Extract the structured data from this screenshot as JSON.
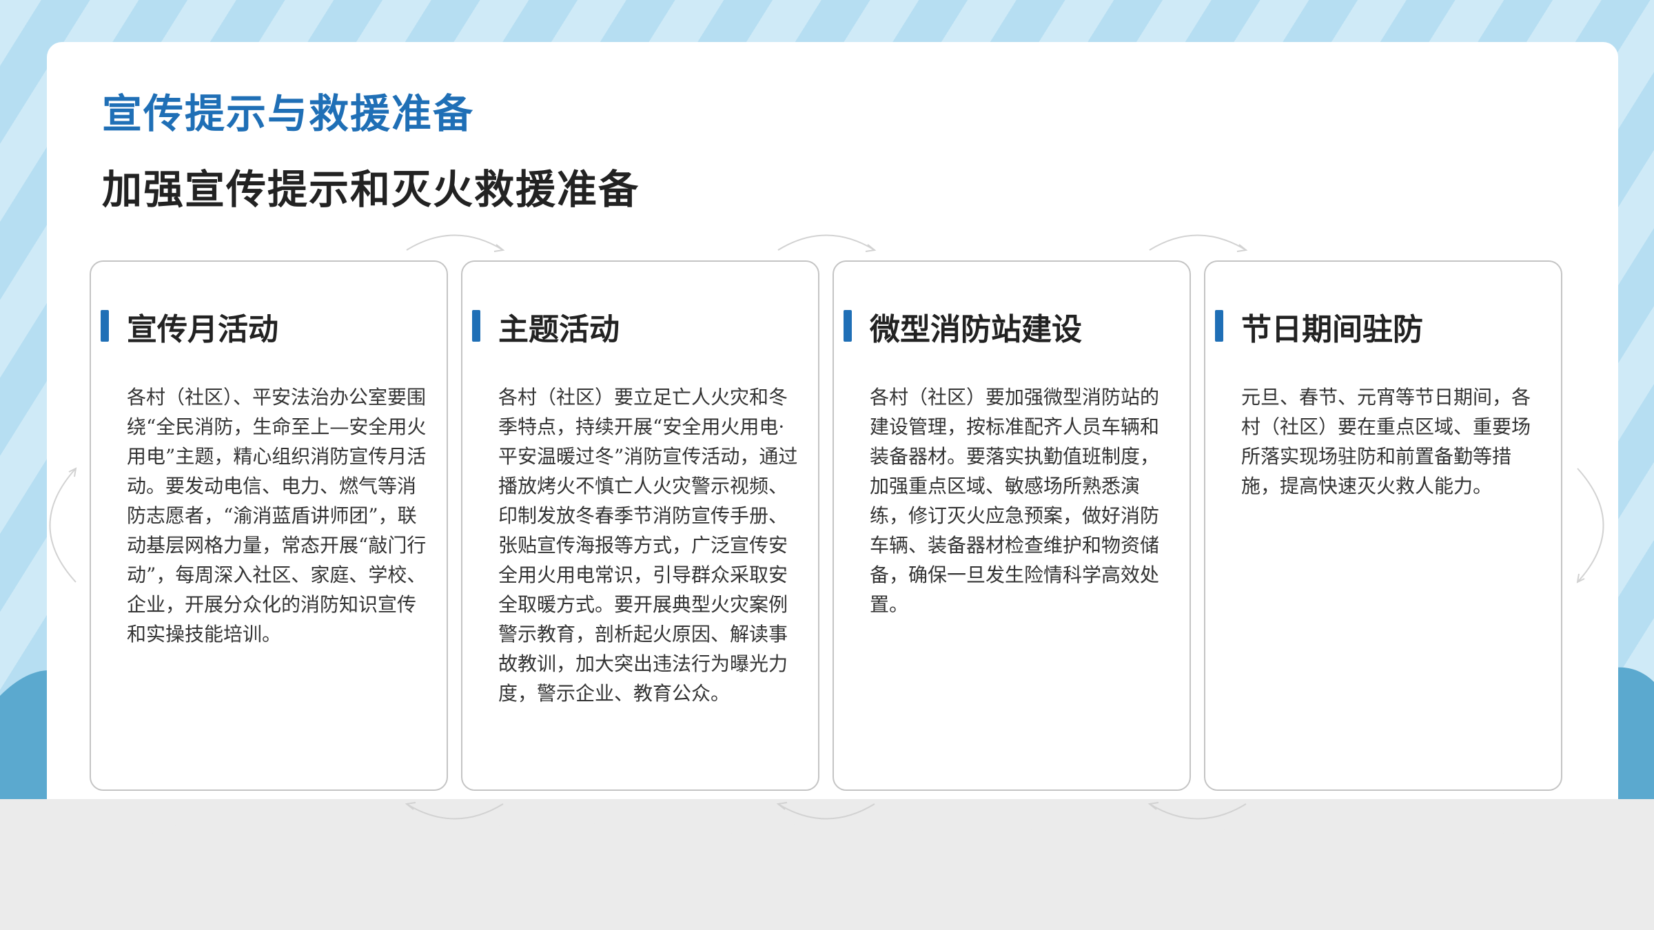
{
  "title": "宣传提示与救援准备",
  "subtitle": "加强宣传提示和灭火救援准备",
  "cards": [
    {
      "heading": "宣传月活动",
      "body": "各村（社区）、平安法治办公室要围绕“全民消防，生命至上—安全用火用电”主题，精心组织消防宣传月活动。要发动电信、电力、燃气等消防志愿者，“渝消蓝盾讲师团”，联动基层网格力量，常态开展“敲门行动”，每周深入社区、家庭、学校、企业，开展分众化的消防知识宣传和实操技能培训。"
    },
    {
      "heading": "主题活动",
      "body": "各村（社区）要立足亡人火灾和冬季特点，持续开展“安全用火用电·平安温暖过冬”消防宣传活动，通过播放烤火不慎亡人火灾警示视频、印制发放冬春季节消防宣传手册、张贴宣传海报等方式，广泛宣传安全用火用电常识，引导群众采取安全取暖方式。要开展典型火灾案例警示教育，剖析起火原因、解读事故教训，加大突出违法行为曝光力度，警示企业、教育公众。"
    },
    {
      "heading": "微型消防站建设",
      "body": "各村（社区）要加强微型消防站的建设管理，按标准配齐人员车辆和装备器材。要落实执勤值班制度，加强重点区域、敏感场所熟悉演练，修订灭火应急预案，做好消防车辆、装备器材检查维护和物资储备，确保一旦发生险情科学高效处置。"
    },
    {
      "heading": "节日期间驻防",
      "body": "元旦、春节、元宵等节日期间，各村（社区）要在重点区域、重要场所落实现场驻防和前置备勤等措施，提高快速灭火救人能力。"
    }
  ],
  "colors": {
    "accent": "#1f6fb6",
    "heading": "#222222",
    "body": "#333333",
    "card_border": "#c4c4c4",
    "background_blue": "#bfe3f4",
    "wave_blue": "#5ba9cf",
    "footer_gray": "#ebebeb"
  }
}
